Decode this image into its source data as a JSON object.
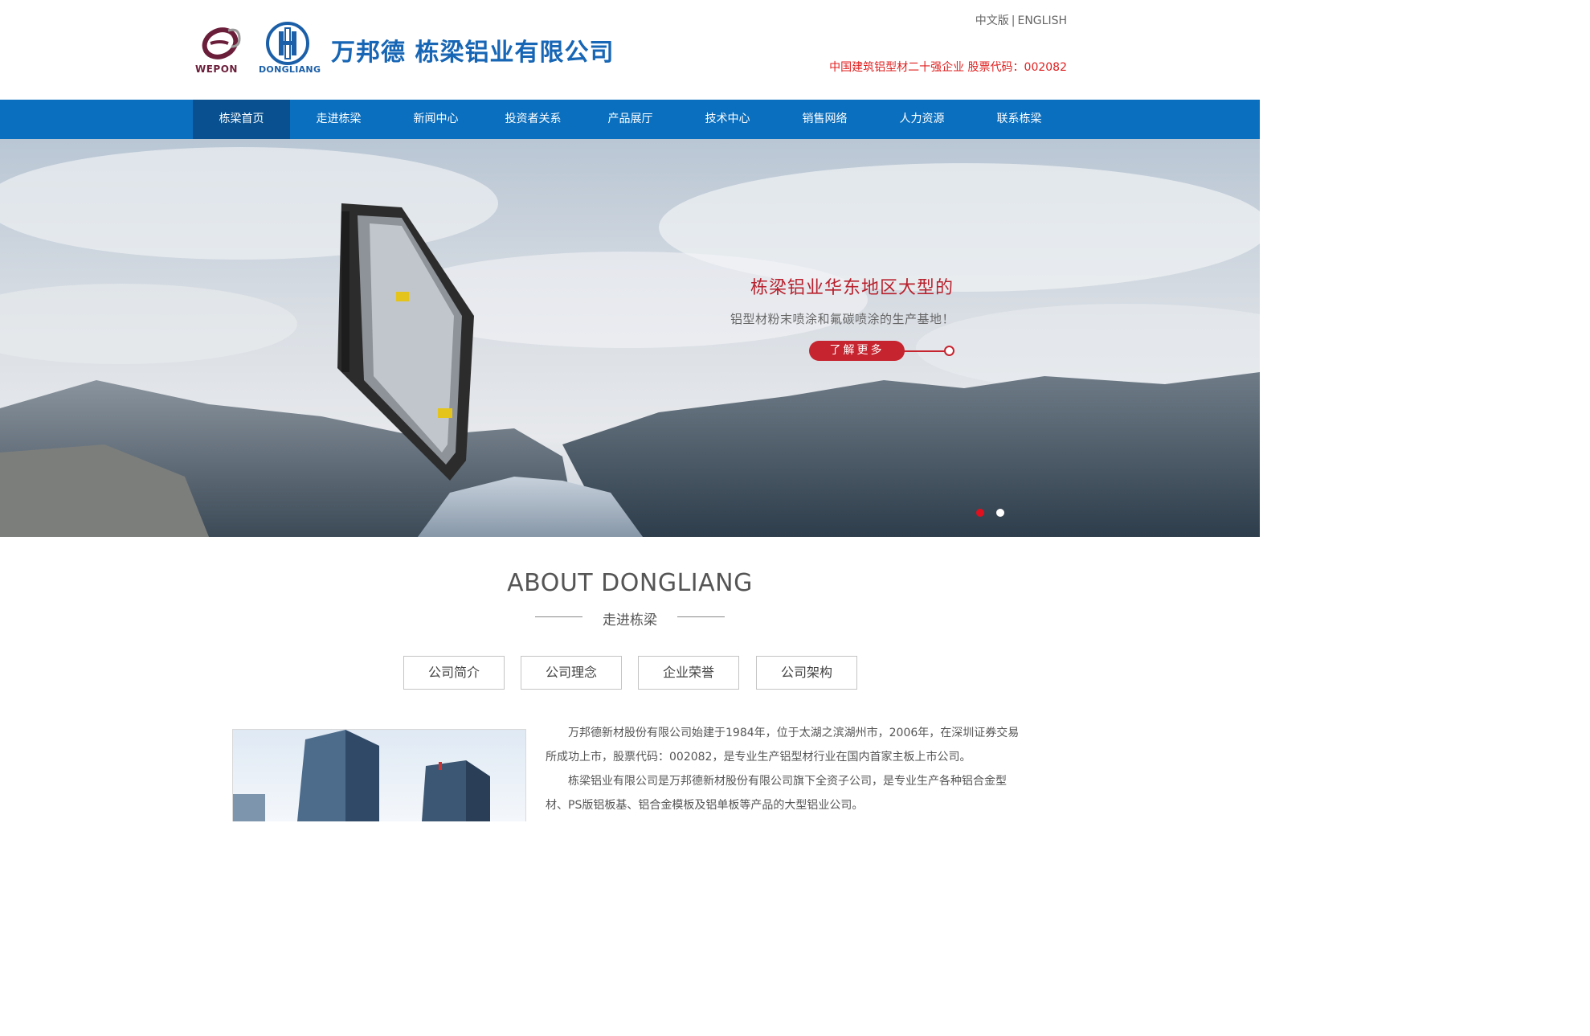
{
  "header": {
    "logo_wepon_text": "WEPON",
    "logo_dongliang_text": "DONGLIANG",
    "company_name": "万邦德  栋梁铝业有限公司",
    "lang_zh": "中文版",
    "lang_sep": "|",
    "lang_en": "ENGLISH",
    "tagline": "中国建筑铝型材二十强企业 股票代码：002082"
  },
  "nav": {
    "items": [
      {
        "label": "栋梁首页"
      },
      {
        "label": "走进栋梁"
      },
      {
        "label": "新闻中心"
      },
      {
        "label": "投资者关系"
      },
      {
        "label": "产品展厅"
      },
      {
        "label": "技术中心"
      },
      {
        "label": "销售网络"
      },
      {
        "label": "人力资源"
      },
      {
        "label": "联系栋梁"
      }
    ],
    "active_index": 0
  },
  "banner": {
    "title": "栋梁铝业华东地区大型的",
    "subtitle": "铝型材粉末喷涂和氟碳喷涂的生产基地！",
    "more_label": "了解更多",
    "slide_count": 2,
    "active_slide": 0
  },
  "about": {
    "title": "ABOUT DONGLIANG",
    "subtitle": "走进栋梁",
    "tabs": [
      {
        "label": "公司简介"
      },
      {
        "label": "公司理念"
      },
      {
        "label": "企业荣誉"
      },
      {
        "label": "公司架构"
      }
    ],
    "paragraphs": [
      "万邦德新材股份有限公司始建于1984年，位于太湖之滨湖州市，2006年，在深圳证券交易所成功上市，股票代码：002082，是专业生产铝型材行业在国内首家主板上市公司。",
      "栋梁铝业有限公司是万邦德新材股份有限公司旗下全资子公司，是专业生产各种铝合金型材、PS版铝板基、铝合金模板及铝单板等产品的大型铝业公司。"
    ]
  },
  "colors": {
    "nav_bg": "#0a6fbf",
    "nav_active": "#08508f",
    "accent_red": "#c6242f",
    "brand_blue": "#1766b5",
    "wepon_maroon": "#6b1e3a"
  }
}
